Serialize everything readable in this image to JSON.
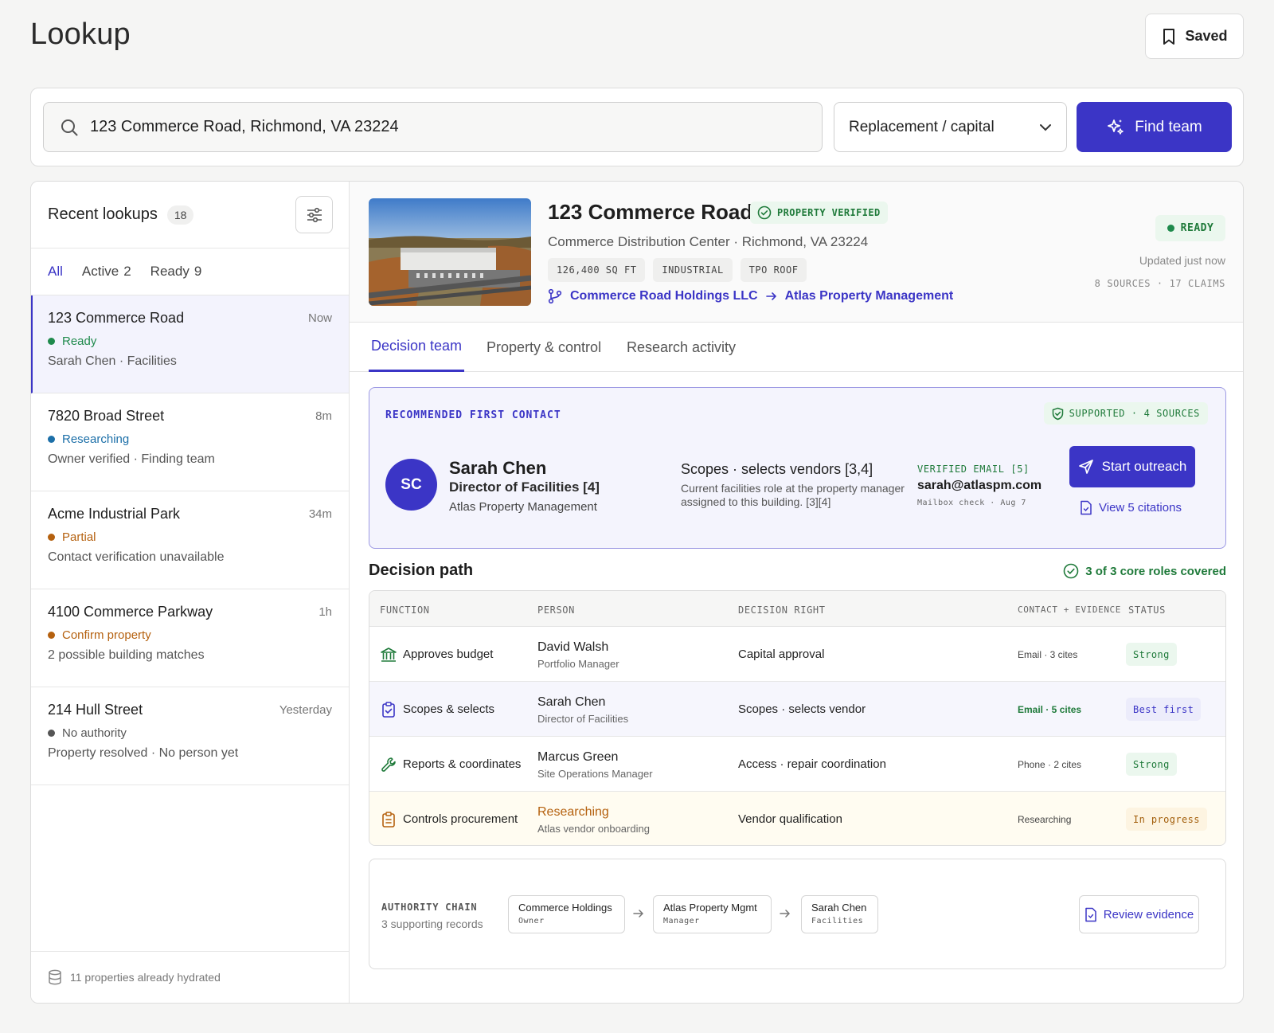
{
  "header": {
    "title": "Lookup",
    "saved_label": "Saved"
  },
  "search": {
    "query": "123 Commerce Road, Richmond, VA 23224",
    "scope": "Replacement / capital",
    "find_label": "Find team"
  },
  "sidebar": {
    "title": "Recent lookups",
    "count": "18",
    "tabs": [
      {
        "label": "All",
        "count": ""
      },
      {
        "label": "Active",
        "count": "2"
      },
      {
        "label": "Ready",
        "count": "9"
      }
    ],
    "items": [
      {
        "name": "123 Commerce Road",
        "time": "Now",
        "status": "Ready",
        "status_color": "#1f8a4c",
        "sub": "Sarah Chen · Facilities"
      },
      {
        "name": "7820 Broad Street",
        "time": "8m",
        "status": "Researching",
        "status_color": "#1c6fa8",
        "sub": "Owner verified · Finding team"
      },
      {
        "name": "Acme Industrial Park",
        "time": "34m",
        "status": "Partial",
        "status_color": "#b5610f",
        "sub": "Contact verification unavailable"
      },
      {
        "name": "4100 Commerce Parkway",
        "time": "1h",
        "status": "Confirm property",
        "status_color": "#b5610f",
        "sub": "2 possible building matches"
      },
      {
        "name": "214 Hull Street",
        "time": "Yesterday",
        "status": "No authority",
        "status_color": "#555555",
        "sub": "Property resolved · No person yet"
      }
    ],
    "footer": "11 properties already hydrated"
  },
  "property": {
    "name": "123 Commerce Road",
    "verified": "PROPERTY VERIFIED",
    "subtitle": "Commerce Distribution Center · Richmond, VA 23224",
    "chips": [
      "126,400 SQ FT",
      "INDUSTRIAL",
      "TPO ROOF"
    ],
    "owner": "Commerce Road Holdings LLC",
    "manager": "Atlas Property Management",
    "status": "READY",
    "updated": "Updated just now",
    "sources": "8 SOURCES · 17 CLAIMS"
  },
  "tabs": [
    "Decision team",
    "Property & control",
    "Research activity"
  ],
  "recommended": {
    "label": "RECOMMENDED FIRST CONTACT",
    "support": "SUPPORTED · 4 SOURCES",
    "initials": "SC",
    "name": "Sarah Chen",
    "title": "Director of Facilities  [4]",
    "org": "Atlas Property Management",
    "scope": "Scopes · selects vendors  [3,4]",
    "scope_desc": "Current facilities role at the property manager assigned to this building. [3][4]",
    "email_label": "VERIFIED EMAIL  [5]",
    "email": "sarah@atlaspm.com",
    "email_note": "Mailbox check · Aug 7",
    "outreach_label": "Start outreach",
    "citations_label": "View 5 citations"
  },
  "decision_path": {
    "title": "Decision path",
    "covered": "3 of 3 core roles covered",
    "headers": [
      "FUNCTION",
      "PERSON",
      "DECISION RIGHT",
      "CONTACT + EVIDENCE",
      "STATUS"
    ],
    "rows": [
      {
        "icon": "bank-icon",
        "function": "Approves budget",
        "person": "David Walsh",
        "role": "Portfolio Manager",
        "right": "Capital approval",
        "contact": "Email · 3 cites",
        "status": "Strong"
      },
      {
        "icon": "clipboard-check-icon",
        "function": "Scopes & selects",
        "person": "Sarah Chen",
        "role": "Director of Facilities",
        "right": "Scopes · selects vendor",
        "contact": "Email · 5 cites",
        "status": "Best first"
      },
      {
        "icon": "wrench-icon",
        "function": "Reports & coordinates",
        "person": "Marcus Green",
        "role": "Site Operations Manager",
        "right": "Access · repair coordination",
        "contact": "Phone · 2 cites",
        "status": "Strong"
      },
      {
        "icon": "clipboard-list-icon",
        "function": "Controls procurement",
        "person": "Researching",
        "role": "Atlas vendor onboarding",
        "right": "Vendor qualification",
        "contact": "Researching",
        "status": "In progress"
      }
    ]
  },
  "authority": {
    "label": "AUTHORITY CHAIN",
    "sub": "3 supporting records",
    "chain": [
      {
        "name": "Commerce Holdings",
        "role": "Owner"
      },
      {
        "name": "Atlas Property Mgmt",
        "role": "Manager"
      },
      {
        "name": "Sarah Chen",
        "role": "Facilities"
      }
    ],
    "review_label": "Review evidence"
  },
  "colors": {
    "accent": "#3b35c6",
    "success": "#1f7a3a",
    "warning": "#a35f0c"
  }
}
